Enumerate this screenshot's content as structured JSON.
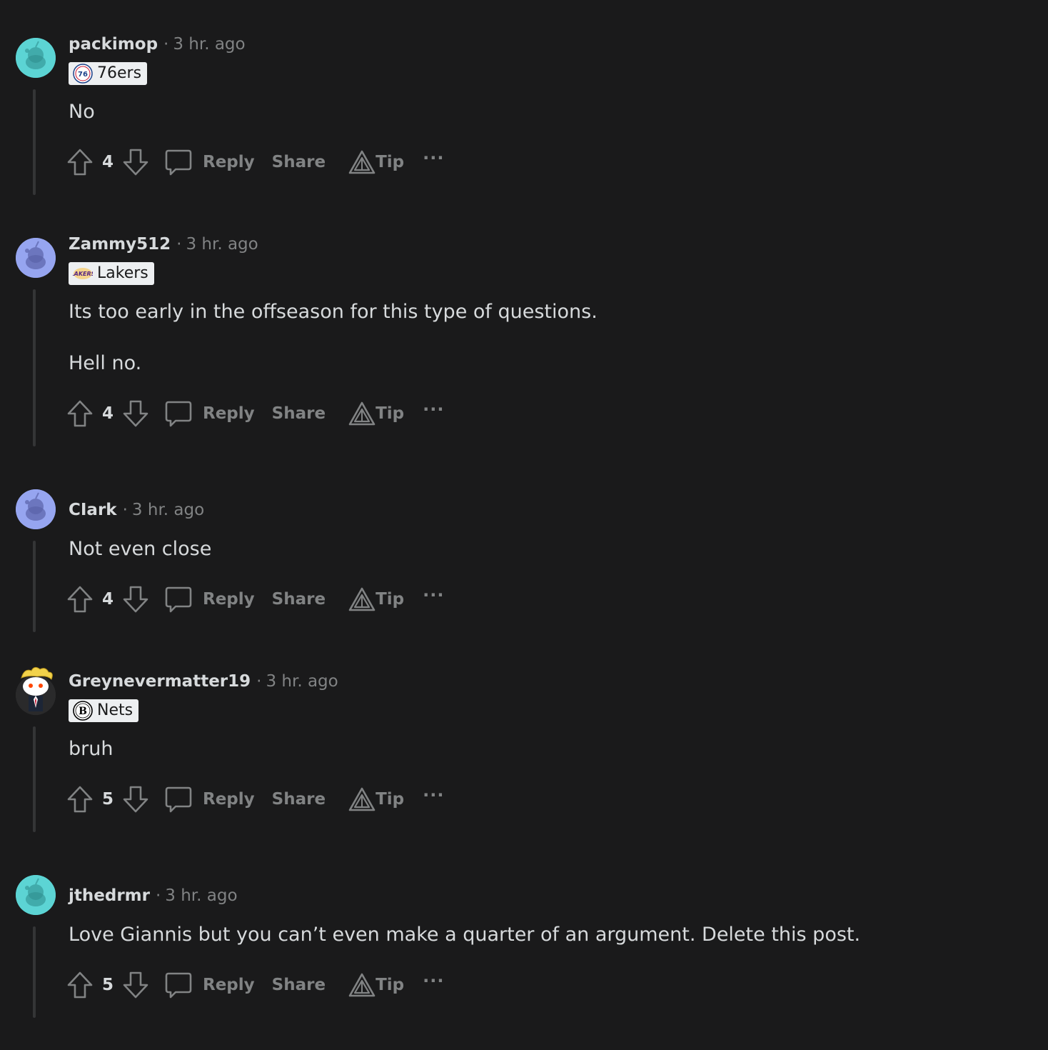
{
  "colors": {
    "background": "#1a1a1b",
    "text": "#d7dadc",
    "muted": "#818384",
    "thread_line": "#343536",
    "flair_bg": "#edeff1"
  },
  "actions": {
    "reply_label": "Reply",
    "share_label": "Share",
    "tip_label": "Tip",
    "more_label": "···"
  },
  "comments": [
    {
      "author": "packimop",
      "time": "3 hr. ago",
      "flair": "76ers",
      "flair_icon": "76ers-logo-icon",
      "avatar_color": "#5cd4d4",
      "body": [
        "No"
      ],
      "score": "4"
    },
    {
      "author": "Zammy512",
      "time": "3 hr. ago",
      "flair": "Lakers",
      "flair_icon": "lakers-logo-icon",
      "avatar_color": "#96a5f0",
      "body": [
        "Its too early in the offseason for this type of questions.",
        "Hell no."
      ],
      "score": "4"
    },
    {
      "author": "CIark",
      "time": "3 hr. ago",
      "flair": "",
      "avatar_color": "#96a5f0",
      "body": [
        "Not even close"
      ],
      "score": "4"
    },
    {
      "author": "Greynevermatter19",
      "time": "3 hr. ago",
      "flair": "Nets",
      "flair_icon": "nets-logo-icon",
      "avatar_color": "#2a2a2b",
      "body": [
        "bruh"
      ],
      "score": "5"
    },
    {
      "author": "jthedrmr",
      "time": "3 hr. ago",
      "flair": "",
      "avatar_color": "#5cd4d4",
      "body": [
        "Love Giannis but you can’t even make a quarter of an argument. Delete this post."
      ],
      "score": "5"
    }
  ]
}
